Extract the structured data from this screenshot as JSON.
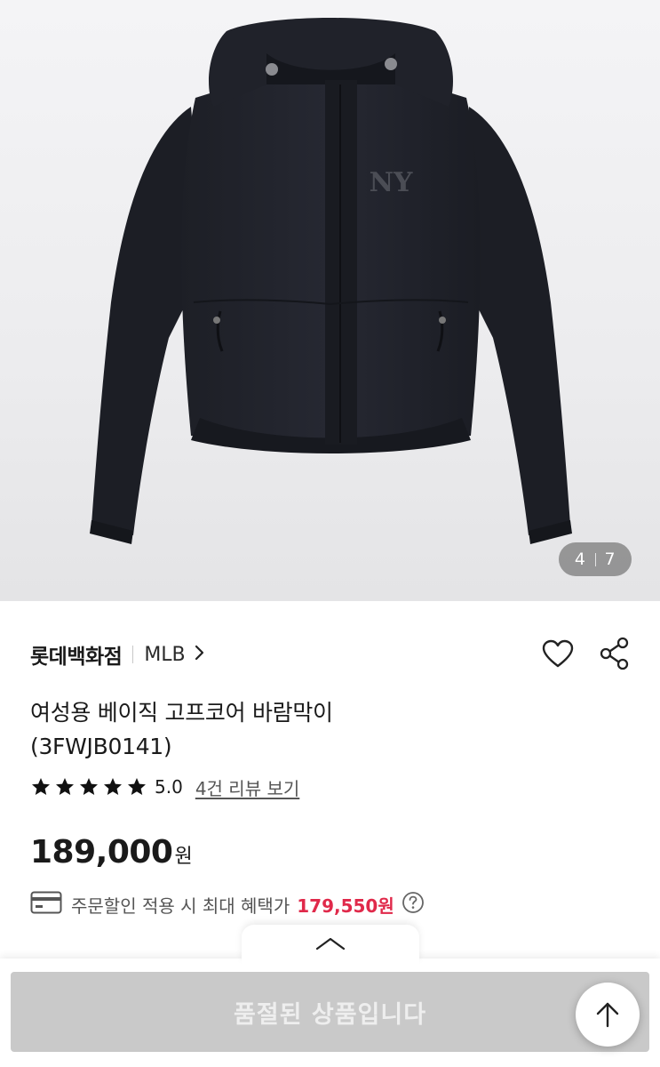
{
  "gallery": {
    "current": "4",
    "total": "7"
  },
  "product": {
    "store": "롯데백화점",
    "brand": "MLB",
    "title_line1": "여성용 베이직 고프코어 바람막이",
    "title_line2": "(3FWJB0141)",
    "rating": "5.0",
    "stars": 5,
    "review_link": "4건 리뷰 보기",
    "price": "189,000",
    "currency": "원",
    "benefit_text": "주문할인 적용 시 최대 혜택가",
    "benefit_price": "179,550원"
  },
  "actions": {
    "soldout_label": "품절된 상품입니다"
  },
  "colors": {
    "accent_red": "#e0294a",
    "soldout_bg": "#c9c9c9"
  },
  "icons": [
    "heart-icon",
    "share-icon",
    "chevron-right-icon",
    "star-icon",
    "card-icon",
    "question-icon",
    "chevron-up-icon",
    "arrow-up-icon"
  ]
}
